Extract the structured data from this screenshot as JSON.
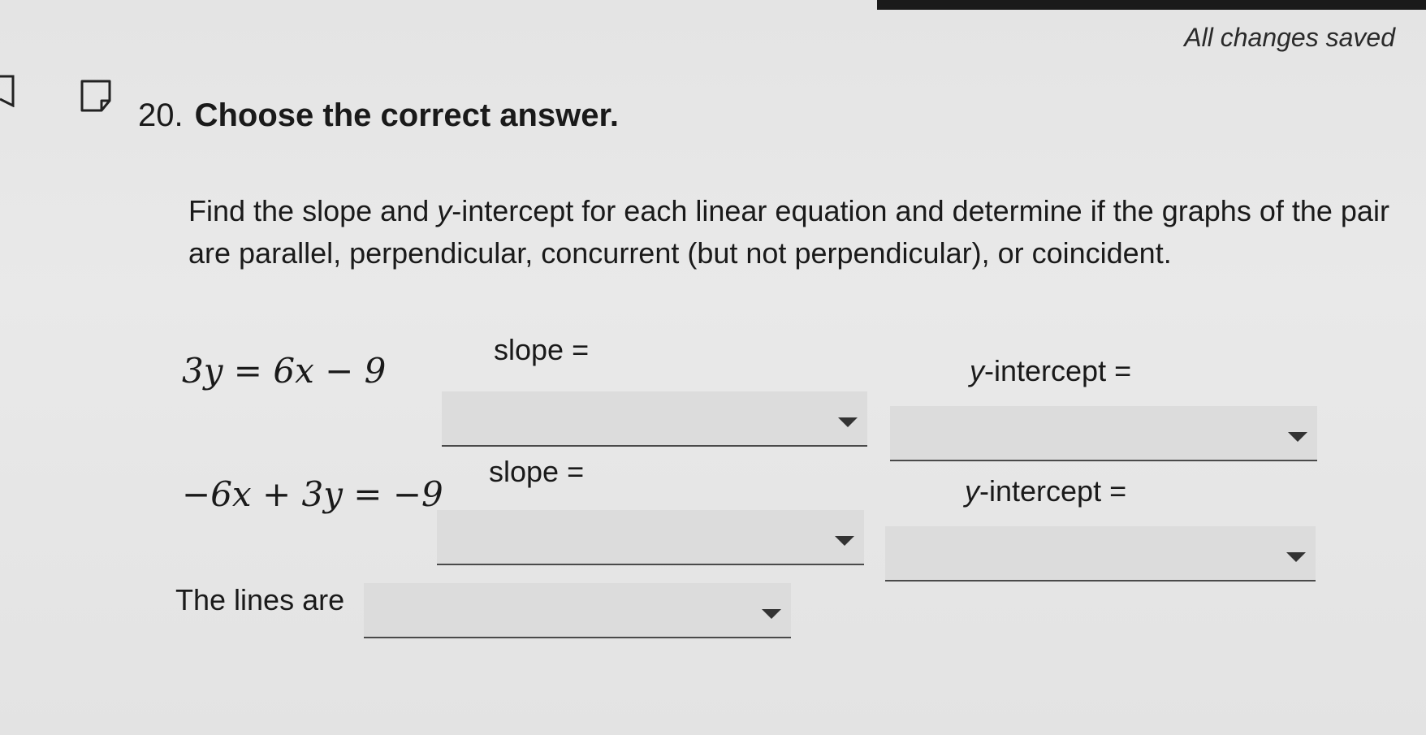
{
  "header": {
    "save_status": "All changes saved"
  },
  "question": {
    "number": "20.",
    "title": "Choose the correct answer.",
    "instructions_before": "Find the slope and ",
    "instructions_italic": "y",
    "instructions_after": "-intercept for each linear equation and determine if the graphs of the pair are parallel, perpendicular, concurrent (but not perpendicular), or coincident."
  },
  "equations": [
    {
      "equation": "3y = 6x − 9",
      "slope_label": "slope =",
      "intercept_label_italic": "y",
      "intercept_label_rest": "-intercept =",
      "slope_value": "",
      "intercept_value": ""
    },
    {
      "equation": "−6x + 3y = −9",
      "slope_label": "slope =",
      "intercept_label_italic": "y",
      "intercept_label_rest": "-intercept =",
      "slope_value": "",
      "intercept_value": ""
    }
  ],
  "relationship": {
    "label": "The lines are",
    "value": ""
  },
  "icons": {
    "note": "note-icon",
    "left_edge": "flag-icon",
    "dropdown_arrow": "caret-down-icon"
  }
}
